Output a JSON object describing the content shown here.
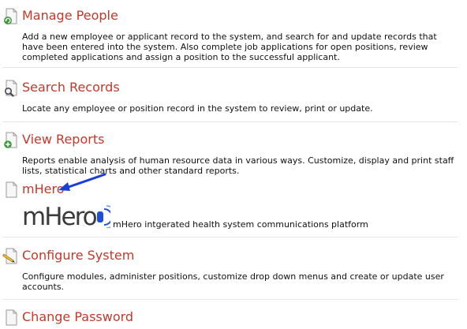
{
  "sections": [
    {
      "title": "Manage People",
      "description": "Add a new employee or applicant record to the system, and search for and update records that have been entered into the system. Also complete job applications for open positions, review completed applications and assign a position to the successful applicant.",
      "icon": "document-refresh-icon"
    },
    {
      "title": "Search Records",
      "description": "Locate any employee or position record in the system to review, print or update.",
      "icon": "document-search-icon"
    },
    {
      "title": "View Reports",
      "description": "Reports enable analysis of human resource data in various ways. Customize, display and print staff lists, statistical charts and other standard reports.",
      "icon": "document-add-icon"
    },
    {
      "title": "mHero",
      "description": "mHero intgerated health system communications platform",
      "logo_text": "mHero",
      "icon": "document-icon"
    },
    {
      "title": "Configure System",
      "description": "Configure modules, administer positions, customize drop down menus and create or update user accounts.",
      "icon": "document-pencil-icon"
    },
    {
      "title": "Change Password",
      "icon": "document-icon"
    }
  ],
  "colors": {
    "link": "#c0392b",
    "annotation_arrow": "#1a3fd6",
    "logo_text": "#3b3b3b",
    "logo_accent": "#1e4fd8"
  }
}
